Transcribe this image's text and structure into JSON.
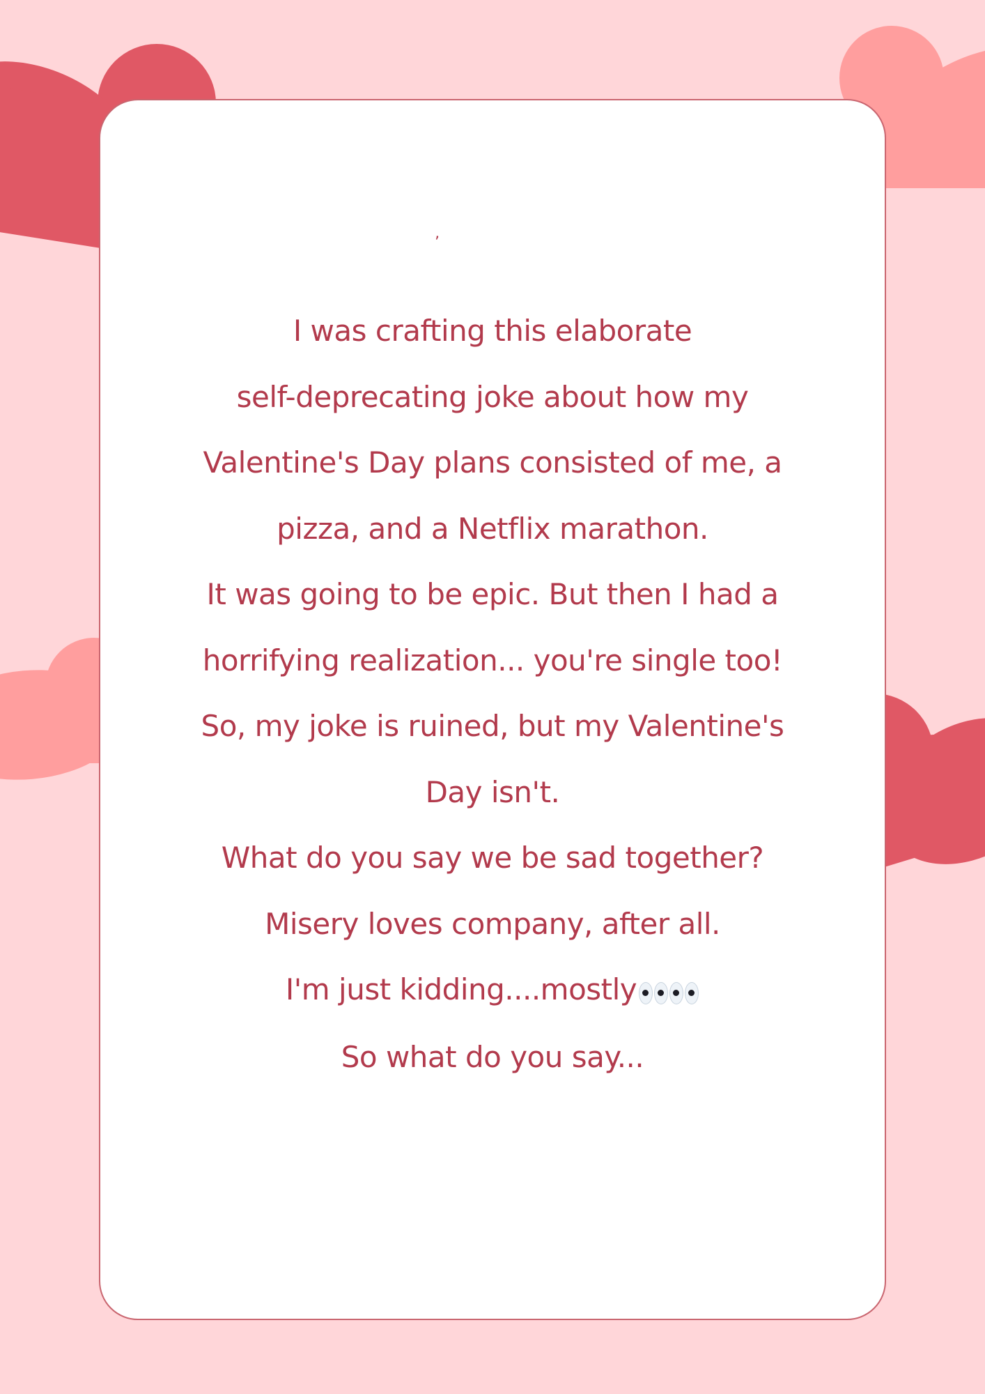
{
  "colors": {
    "background": "#ffd6d9",
    "card": "#ffffff",
    "card_border": "#c9656f",
    "text": "#b23a4c",
    "heart_dark": "#e05865",
    "heart_light": "#ff9e9e"
  },
  "decorations": {
    "tick_mark": "’",
    "emoji_icon": "eyes-icon"
  },
  "message": {
    "lines": [
      "I was crafting this elaborate",
      "self-deprecating joke about how my",
      "Valentine's Day plans consisted of me, a",
      "pizza, and a Netflix marathon.",
      "It was going to be epic.  But then I had a",
      "horrifying realization... you're single too!",
      "So, my joke is ruined, but my Valentine's",
      "Day isn't.",
      "What do you say we be sad together?",
      "Misery loves company, after all.",
      "I'm just kidding....mostly",
      "So what do you say..."
    ]
  }
}
